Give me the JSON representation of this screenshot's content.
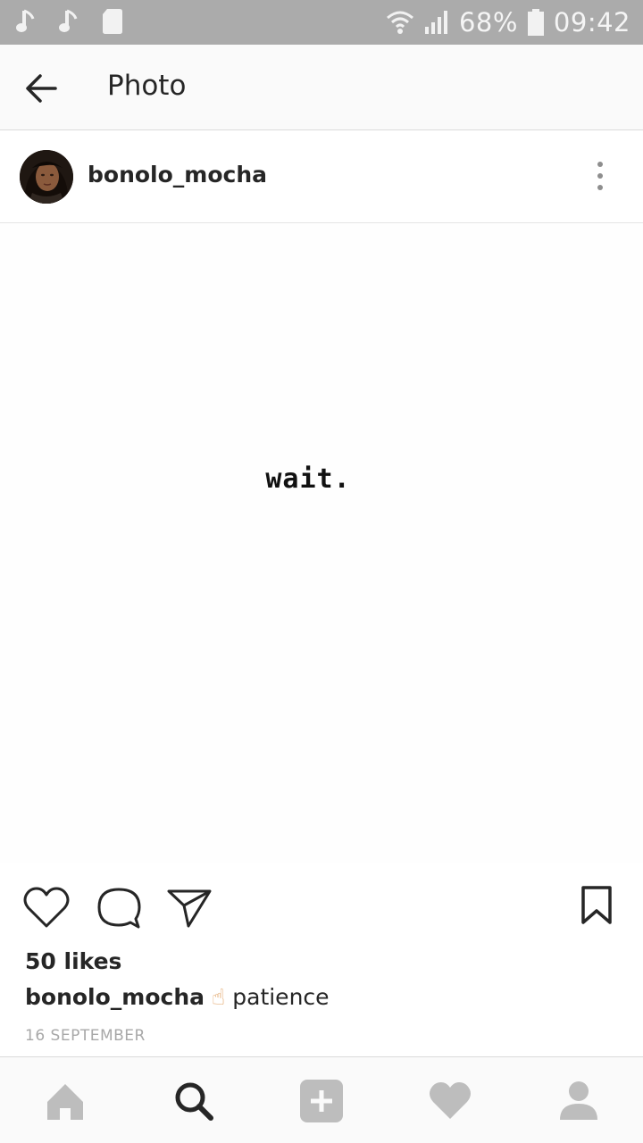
{
  "status_bar": {
    "battery_percent": "68%",
    "time": "09:42",
    "icons": [
      "music-note-icon",
      "music-note-icon",
      "sd-card-icon",
      "wifi-icon",
      "signal-icon",
      "battery-icon"
    ]
  },
  "appbar": {
    "title": "Photo",
    "back_icon": "arrow-left-icon"
  },
  "post": {
    "username": "bonolo_mocha",
    "more_icon": "more-vertical-icon",
    "photo_text": "wait.",
    "likes": "50 likes",
    "caption_user": "bonolo_mocha",
    "caption_emoji": "☝",
    "caption_text": "patience",
    "date": "16 SEPTEMBER",
    "actions": [
      "heart-icon",
      "comment-icon",
      "share-icon",
      "bookmark-icon"
    ]
  },
  "bottom_nav": {
    "items": [
      "home-icon",
      "search-icon",
      "add-icon",
      "activity-heart-icon",
      "profile-icon"
    ]
  },
  "colors": {
    "statusbar": "#ababab",
    "appbar": "#fafafa",
    "text": "#262626",
    "muted": "#a8a8a8",
    "nav_inactive": "#bdbdbd"
  }
}
